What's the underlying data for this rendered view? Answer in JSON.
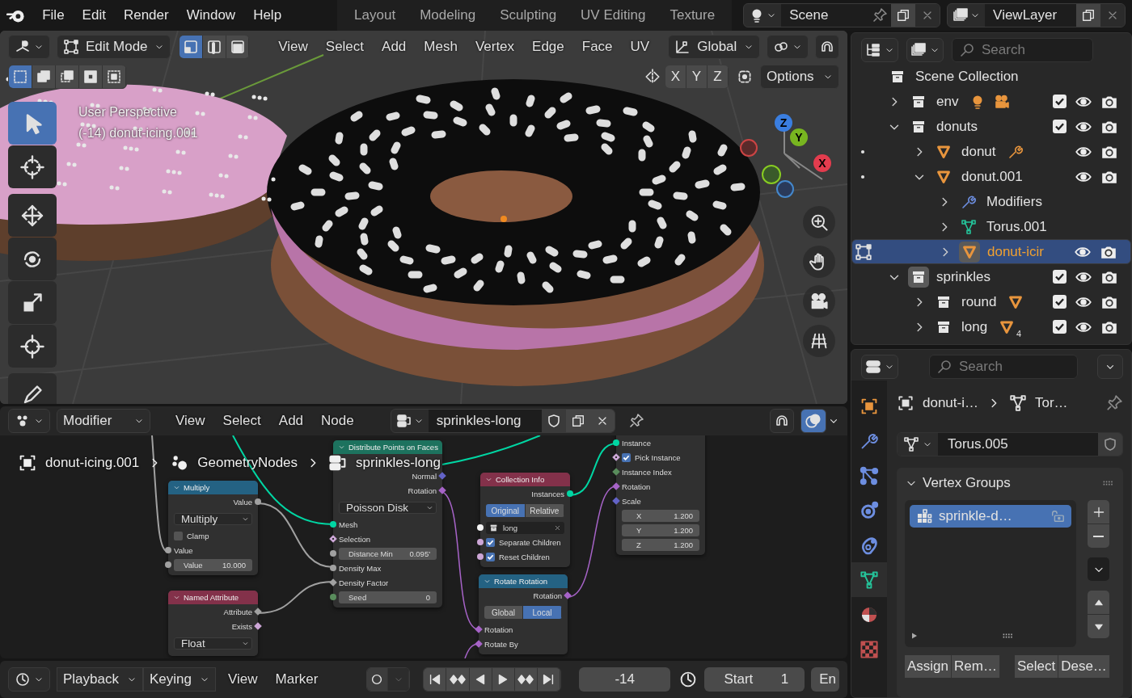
{
  "topbar": {
    "menus": [
      "File",
      "Edit",
      "Render",
      "Window",
      "Help"
    ],
    "workspaces": [
      {
        "label": "Layout",
        "selected": false
      },
      {
        "label": "Modeling",
        "selected": false
      },
      {
        "label": "Sculpting",
        "selected": false
      },
      {
        "label": "UV Editing",
        "selected": false
      },
      {
        "label": "Texture",
        "selected": false
      }
    ],
    "scene": "Scene",
    "view_layer": "ViewLayer"
  },
  "viewport": {
    "mode": "Edit Mode",
    "select_modes": [
      {
        "kind": "vertex",
        "selected": true
      },
      {
        "kind": "edge",
        "selected": false
      },
      {
        "kind": "face",
        "selected": false
      }
    ],
    "menus": [
      "View",
      "Select",
      "Add",
      "Mesh",
      "Vertex",
      "Edge",
      "Face",
      "UV"
    ],
    "orientation": "Global",
    "axes": [
      "X",
      "Y",
      "Z"
    ],
    "options": "Options",
    "select_tools": [
      {
        "kind": "new",
        "selected": true
      },
      {
        "kind": "extend",
        "selected": false
      },
      {
        "kind": "subtract",
        "selected": false
      },
      {
        "kind": "invert",
        "selected": false
      },
      {
        "kind": "intersect",
        "selected": false
      }
    ],
    "view_name": "User Perspective",
    "object_info": "(-14) donut-icing.001",
    "tools": [
      {
        "kind": "select",
        "selected": true
      },
      {
        "kind": "cursor",
        "selected": false
      },
      {
        "kind": "move",
        "selected": false
      },
      {
        "kind": "rotate",
        "selected": false
      },
      {
        "kind": "scale",
        "selected": false
      },
      {
        "kind": "transform",
        "selected": false
      },
      {
        "kind": "annotate",
        "selected": false
      }
    ],
    "gizmo": {
      "z": "Z",
      "y": "Y",
      "x": "X"
    }
  },
  "node_editor": {
    "editor_type": "Modifier",
    "menus": [
      "View",
      "Select",
      "Add",
      "Node"
    ],
    "node_group": "sprinkles-long",
    "overlay": true,
    "breadcrumbs": [
      {
        "kind": "object",
        "label": "donut-icing.001"
      },
      {
        "kind": "modifier",
        "label": "GeometryNodes"
      },
      {
        "kind": "node_tree",
        "label": "sprinkles-long"
      }
    ],
    "nodes": [
      {
        "title": "Multiply",
        "color": "#246283",
        "rows": [
          {
            "kind": "output",
            "label": "Value",
            "socket": {
              "kind": "circle",
              "color": "#a1a1a1"
            }
          },
          {
            "kind": "dropdown",
            "value": "Multiply"
          },
          {
            "kind": "checkbox",
            "label": "Clamp",
            "checked": false
          },
          {
            "kind": "input",
            "label": "Value",
            "socket": {
              "kind": "circle",
              "color": "#a1a1a1"
            }
          },
          {
            "kind": "field",
            "label": "Value",
            "value": "10.000",
            "socket": {
              "kind": "circle",
              "color": "#a1a1a1"
            }
          }
        ]
      },
      {
        "title": "Named Attribute",
        "color": "#83314a",
        "rows": [
          {
            "kind": "output",
            "label": "Attribute",
            "socket": {
              "kind": "diamond",
              "color": "#a1a1a1"
            }
          },
          {
            "kind": "output",
            "label": "Exists",
            "socket": {
              "kind": "diamond",
              "color": "#cca6d6"
            }
          },
          {
            "kind": "dropdown",
            "value": "Float"
          }
        ]
      },
      {
        "title": "Distribute Points on Faces",
        "color": "#1d725e",
        "rows": [
          {
            "kind": "output",
            "label": "Normal",
            "socket": {
              "kind": "diamond",
              "color": "#6363c7"
            }
          },
          {
            "kind": "output",
            "label": "Rotation",
            "socket": {
              "kind": "diamond",
              "color": "#a663c7"
            }
          },
          {
            "kind": "dropdown",
            "value": "Poisson Disk"
          },
          {
            "kind": "input",
            "label": "Mesh",
            "socket": {
              "kind": "circle",
              "color": "#00d6a3"
            }
          },
          {
            "kind": "input",
            "label": "Selection",
            "socket": {
              "kind": "hollow",
              "color": "#cca6d6"
            }
          },
          {
            "kind": "field",
            "label": "Distance Min",
            "value": "0.095'",
            "socket": {
              "kind": "circle",
              "color": "#a1a1a1"
            }
          },
          {
            "kind": "input",
            "label": "Density Max",
            "socket": {
              "kind": "circle",
              "color": "#a1a1a1"
            }
          },
          {
            "kind": "input",
            "label": "Density Factor",
            "socket": {
              "kind": "diamond",
              "color": "#a1a1a1"
            }
          },
          {
            "kind": "field",
            "label": "Seed",
            "value": "0",
            "socket": {
              "kind": "circle",
              "color": "#598c5c"
            }
          }
        ]
      },
      {
        "title": "Collection Info",
        "color": "#83314a",
        "rows": [
          {
            "kind": "output",
            "label": "Instances",
            "socket": {
              "kind": "circle",
              "color": "#00d6a3"
            }
          },
          {
            "kind": "toggle",
            "options": [
              {
                "label": "Original",
                "selected": true
              },
              {
                "label": "Relative",
                "selected": false
              }
            ]
          },
          {
            "kind": "collection",
            "value": "long",
            "socket": {
              "kind": "circle",
              "color": "#f5f5f5"
            }
          },
          {
            "kind": "checkbox",
            "label": "Separate Children",
            "checked": true,
            "socket": {
              "kind": "circle",
              "color": "#cca6d6"
            }
          },
          {
            "kind": "checkbox",
            "label": "Reset Children",
            "checked": true,
            "socket": {
              "kind": "circle",
              "color": "#cca6d6"
            }
          }
        ]
      },
      {
        "title": "Rotate Rotation",
        "color": "#246283",
        "rows": [
          {
            "kind": "output",
            "label": "Rotation",
            "socket": {
              "kind": "diamond",
              "color": "#a663c7"
            }
          },
          {
            "kind": "toggle",
            "options": [
              {
                "label": "Global",
                "selected": false
              },
              {
                "label": "Local",
                "selected": true
              }
            ]
          },
          {
            "kind": "input",
            "label": "Rotation",
            "socket": {
              "kind": "diamond",
              "color": "#a663c7"
            }
          },
          {
            "kind": "input",
            "label": "Rotate By",
            "socket": {
              "kind": "diamond",
              "color": "#a663c7"
            }
          }
        ]
      },
      {
        "rows": [
          {
            "kind": "input",
            "label": "Instance",
            "socket": {
              "kind": "circle",
              "color": "#00d6a3"
            }
          },
          {
            "kind": "checkbox",
            "label": "Pick Instance",
            "checked": true,
            "socket": {
              "kind": "hollow",
              "color": "#cca6d6"
            }
          },
          {
            "kind": "input",
            "label": "Instance Index",
            "socket": {
              "kind": "diamond",
              "color": "#598c5c"
            }
          },
          {
            "kind": "input",
            "label": "Rotation",
            "socket": {
              "kind": "diamond",
              "color": "#a663c7"
            }
          },
          {
            "kind": "input",
            "label": "Scale",
            "socket": {
              "kind": "diamond",
              "color": "#6363c7"
            }
          },
          {
            "kind": "field",
            "label": "X",
            "value": "1.200"
          },
          {
            "kind": "field",
            "label": "Y",
            "value": "1.200"
          },
          {
            "kind": "field",
            "label": "Z",
            "value": "1.200"
          }
        ]
      }
    ]
  },
  "timeline": {
    "dropdowns": [
      "Playback",
      "Keying"
    ],
    "menus": [
      "View",
      "Marker"
    ],
    "frame": "-14",
    "start_label": "Start",
    "start": "1",
    "end_label": "En"
  },
  "outliner": {
    "search_placeholder": "Search",
    "root": "Scene Collection",
    "items": [
      {
        "label": "env",
        "kind": "collection",
        "expanded": false,
        "selected": false,
        "active": false,
        "checked": true,
        "contents": [
          {
            "kind": "light"
          },
          {
            "kind": "camera"
          }
        ]
      },
      {
        "label": "donuts",
        "kind": "collection",
        "expanded": true,
        "selected": false,
        "active": false,
        "checked": true,
        "children": [
          {
            "label": "donut",
            "kind": "mesh",
            "expanded": false,
            "selected": false,
            "active": false,
            "marker": {
              "kind": "dot"
            },
            "contents": [
              {
                "kind": "modifier"
              }
            ]
          },
          {
            "label": "donut.001",
            "kind": "mesh",
            "expanded": true,
            "selected": false,
            "active": false,
            "marker": {
              "kind": "dot"
            },
            "children": [
              {
                "label": "Modifiers",
                "kind": "modifiers",
                "expanded": false,
                "selected": false,
                "active": false
              },
              {
                "label": "Torus.001",
                "kind": "mesh_data",
                "expanded": false,
                "selected": false,
                "active": false
              },
              {
                "label": "donut-icir",
                "kind": "mesh",
                "expanded": false,
                "selected": true,
                "active": true,
                "marker": {
                  "kind": "edit"
                }
              }
            ]
          }
        ]
      },
      {
        "label": "sprinkles",
        "kind": "collection",
        "expanded": true,
        "selected": false,
        "active": true,
        "checked": true,
        "children": [
          {
            "label": "round",
            "kind": "collection",
            "expanded": false,
            "selected": false,
            "active": false,
            "checked": true,
            "contents": [
              {
                "kind": "mesh"
              }
            ]
          },
          {
            "label": "long",
            "kind": "collection",
            "expanded": false,
            "selected": false,
            "active": false,
            "checked": true,
            "contents": [
              {
                "kind": "mesh",
                "count": "4"
              }
            ]
          }
        ]
      }
    ]
  },
  "properties": {
    "search_placeholder": "Search",
    "tabs": [
      {
        "kind": "object",
        "selected": false
      },
      {
        "kind": "modifiers",
        "selected": false
      },
      {
        "kind": "particles",
        "selected": false
      },
      {
        "kind": "physics",
        "selected": false
      },
      {
        "kind": "constraints",
        "selected": false
      },
      {
        "kind": "data",
        "selected": true
      },
      {
        "kind": "material",
        "selected": false
      },
      {
        "kind": "texture",
        "selected": false
      }
    ],
    "breadcrumbs": [
      "donut-i…",
      "Tor…"
    ],
    "mesh_name": "Torus.005",
    "panel": {
      "title": "Vertex Groups",
      "expanded": true,
      "groups": [
        {
          "label": "sprinkle-d…",
          "selected": true
        }
      ],
      "buttons": [
        "Assign",
        "Rem…",
        "Select",
        "Dese…"
      ]
    }
  }
}
